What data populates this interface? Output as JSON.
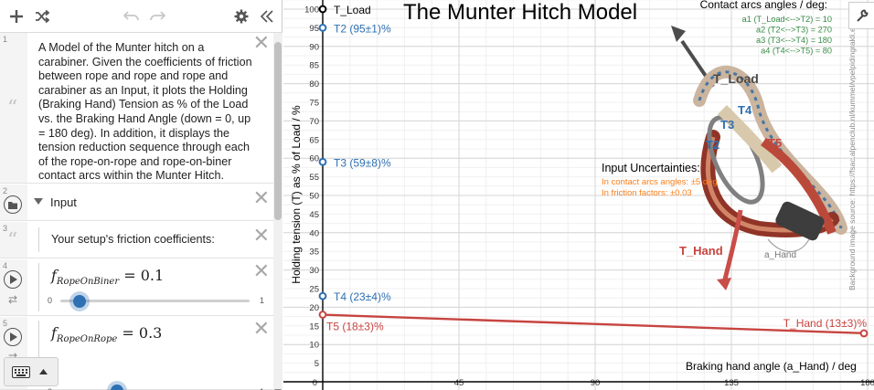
{
  "toolbar": {
    "add_icon": "plus-icon",
    "shuffle_icon": "shuffle-icon",
    "undo_icon": "undo-icon",
    "redo_icon": "redo-icon",
    "settings_icon": "gear-icon",
    "collapse_icon": "double-chevron-left-icon"
  },
  "expressions": {
    "n1": "1",
    "n2": "2",
    "n3": "3",
    "n4": "4",
    "n5": "5",
    "note1": "A Model of the Munter hitch on a carabiner. Given the coefficients of friction between rope and rope and rope and carabiner as an Input, it plots the Holding (Braking Hand) Tension as % of the Load vs. the Braking Hand Angle (down = 0, up = 180 deg).  In addition, it displays the tension reduction sequence through each of the rope-on-rope and rope-on-biner contact arcs within the Munter Hitch.",
    "folder_label": "Input",
    "note3": "Your setup's friction coefficients:",
    "slider1": {
      "var": "f",
      "sub": "RopeOnBiner",
      "value": "0.1",
      "min": "0",
      "max": "1",
      "fraction": 0.1
    },
    "slider2": {
      "var": "f",
      "sub": "RopeOnRope",
      "value": "0.3",
      "min": "0",
      "max": "1",
      "fraction": 0.3
    }
  },
  "graph": {
    "title": "The Munter Hitch Model",
    "ylabel": "Holding tension (T) as % of Load / %",
    "xlabel": "Braking hand angle (a_Hand) / deg",
    "contact_title": "Contact arcs angles / deg:",
    "contact_lines": [
      "a1 (T_Load<-->T2) = 10",
      "a2 (T2<-->T3) = 270",
      "a3 (T3<-->T4) = 180",
      "a4 (T4<-->T5) = 80"
    ],
    "uncert_title": "Input Uncertainties:",
    "uncert_lines": [
      "In contact arcs angles: ±5 deg",
      "In friction factors: ±0.03"
    ],
    "bg_source": "Background image source: https://fsac.alpenclub.nl/kummel/vpelpidingrakli.en",
    "diagram_labels": {
      "tload": "T_Load",
      "t2": "T2",
      "t3": "T3",
      "t4": "T4",
      "t5": "T5",
      "thand": "T_Hand",
      "ahand": "a_Hand"
    },
    "colors": {
      "blue": "#2d70b3",
      "red": "#c74440",
      "green": "#388c46",
      "orange": "#fa7e19",
      "black": "#000000"
    }
  },
  "chart_data": {
    "type": "line",
    "x_ticks": [
      "45",
      "90",
      "135",
      "180"
    ],
    "y_ticks": [
      "0",
      "5",
      "10",
      "15",
      "20",
      "25",
      "30",
      "35",
      "40",
      "45",
      "50",
      "55",
      "60",
      "65",
      "70",
      "75",
      "80",
      "85",
      "90",
      "95",
      "100"
    ],
    "xlim": [
      0,
      180
    ],
    "ylim": [
      0,
      100
    ],
    "grid": true,
    "points": [
      {
        "label": "T_Load",
        "x": 0,
        "y": 100,
        "color": "#000000"
      },
      {
        "label": "T2 (95±1)%",
        "x": 0,
        "y": 95,
        "color": "#2d70b3"
      },
      {
        "label": "T3 (59±8)%",
        "x": 0,
        "y": 59,
        "color": "#2d70b3"
      },
      {
        "label": "T4 (23±4)%",
        "x": 0,
        "y": 23,
        "color": "#2d70b3"
      },
      {
        "label": "T5 (18±3)%",
        "x": 0,
        "y": 18,
        "color": "#c74440"
      },
      {
        "label": "T_Hand (13±3)%",
        "x": 180,
        "y": 13,
        "color": "#c74440"
      }
    ],
    "series": [
      {
        "name": "",
        "x": [
          0,
          180
        ],
        "y": [
          18,
          13
        ],
        "color": "#c74440"
      }
    ]
  }
}
